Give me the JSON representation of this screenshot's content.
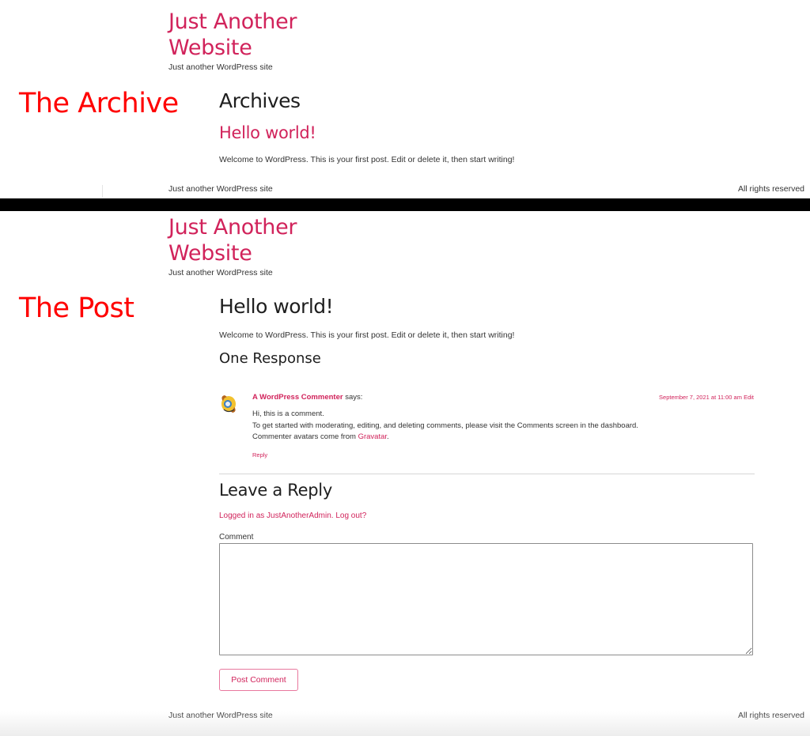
{
  "archive_panel": {
    "label": "The Archive",
    "site_title_line1": "Just Another",
    "site_title_line2": "Website",
    "tagline": "Just another WordPress site",
    "page_heading": "Archives",
    "post_title": "Hello world!",
    "post_excerpt": "Welcome to WordPress. This is your first post. Edit or delete it, then start writing!",
    "footer_left": "Just another WordPress site",
    "footer_right": "All rights reserved"
  },
  "post_panel": {
    "label": "The Post",
    "site_title_line1": "Just Another",
    "site_title_line2": "Website",
    "tagline": "Just another WordPress site",
    "post_title": "Hello world!",
    "post_content": "Welcome to WordPress. This is your first post. Edit or delete it, then start writing!",
    "comments_heading": "One Response",
    "comment": {
      "author": "A WordPress Commenter",
      "says": " says:",
      "date": "September 7, 2021 at 11:00 am",
      "edit_label": "Edit",
      "line1": "Hi, this is a comment.",
      "line2": "To get started with moderating, editing, and deleting comments, please visit the Comments screen in the dashboard.",
      "line3_prefix": "Commenter avatars come from ",
      "line3_link": "Gravatar",
      "line3_suffix": ".",
      "reply_label": "Reply"
    },
    "reply_form": {
      "heading": "Leave a Reply",
      "logged_in_text": "Logged in as JustAnotherAdmin.",
      "logout_label": "Log out?",
      "comment_label": "Comment",
      "comment_value": "",
      "submit_label": "Post Comment"
    },
    "footer_left": "Just another WordPress site",
    "footer_right": "All rights reserved"
  },
  "colors": {
    "accent": "#d1235b",
    "label_red": "#ff0000",
    "text": "#1e1e1e",
    "divider_band": "#000000"
  }
}
